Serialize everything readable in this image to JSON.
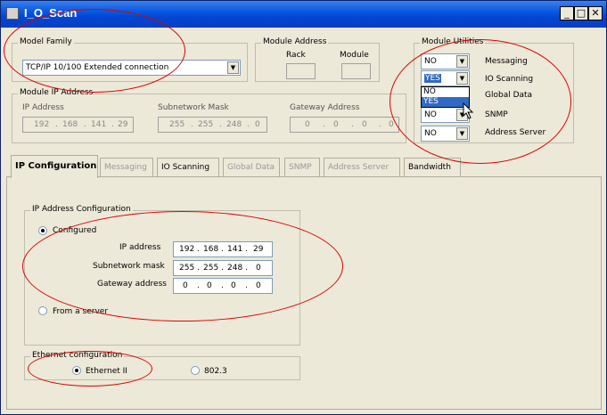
{
  "window": {
    "title": "I_O_Scan"
  },
  "module_family": {
    "label": "Model Family",
    "value": "TCP/IP 10/100 Extended connection"
  },
  "module_address": {
    "label": "Module Address",
    "rack_label": "Rack",
    "module_label": "Module"
  },
  "module_ip": {
    "label": "Module IP Address",
    "ip_label": "IP Address",
    "ip": [
      "192",
      "168",
      "141",
      "29"
    ],
    "mask_label": "Subnetwork Mask",
    "mask": [
      "255",
      "255",
      "248",
      "0"
    ],
    "gw_label": "Gateway Address",
    "gw": [
      "0",
      "0",
      "0",
      "0"
    ]
  },
  "utilities": {
    "label": "Module Utilities",
    "rows": [
      {
        "value": "NO",
        "label": "Messaging"
      },
      {
        "value": "YES",
        "label": "IO Scanning"
      },
      {
        "value": "",
        "label": "Global Data"
      },
      {
        "value": "NO",
        "label": "SNMP"
      },
      {
        "value": "NO",
        "label": "Address Server"
      }
    ],
    "dropdown_options": [
      "NO",
      "YES"
    ]
  },
  "tabs": [
    {
      "label": "IP Configuration",
      "state": "active"
    },
    {
      "label": "Messaging",
      "state": "disabled"
    },
    {
      "label": "IO Scanning",
      "state": "enabled"
    },
    {
      "label": "Global Data",
      "state": "disabled"
    },
    {
      "label": "SNMP",
      "state": "disabled"
    },
    {
      "label": "Address Server",
      "state": "disabled"
    },
    {
      "label": "Bandwidth",
      "state": "enabled"
    }
  ],
  "ip_config": {
    "label": "IP Address Configuration",
    "configured_label": "Configured",
    "ip_label": "IP address",
    "ip": [
      "192",
      "168",
      "141",
      "29"
    ],
    "mask_label": "Subnetwork mask",
    "mask": [
      "255",
      "255",
      "248",
      "0"
    ],
    "gw_label": "Gateway address",
    "gw": [
      "0",
      "0",
      "0",
      "0"
    ],
    "server_label": "From a server"
  },
  "ethernet": {
    "label": "Ethernet configuration",
    "opt1": "Ethernet II",
    "opt2": "802.3"
  },
  "colors": {
    "highlight": "#cc0000",
    "selection": "#316ac5",
    "titlebar": "#0046d5"
  }
}
